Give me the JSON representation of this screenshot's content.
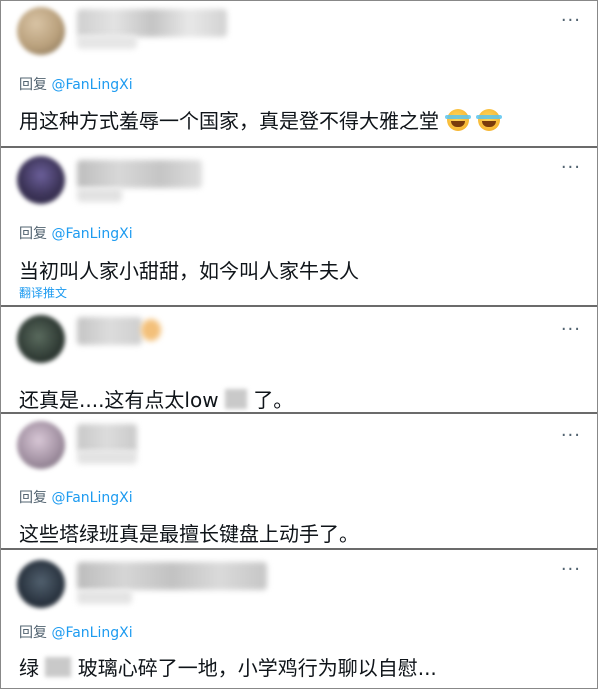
{
  "ui": {
    "more_glyph": "···",
    "reply_prefix": "回复",
    "translate_label": "翻译推文"
  },
  "tweets": [
    {
      "reply_to": "@FanLingXi",
      "text": "用这种方式羞辱一个国家，真是登不得大雅之堂",
      "emoji": [
        "face-with-tears-of-joy",
        "face-with-tears-of-joy"
      ]
    },
    {
      "reply_to": "@FanLingXi",
      "text": "当初叫人家小甜甜，如今叫人家牛夫人",
      "has_translate": true
    },
    {
      "text_before": "还真是....这有点太low",
      "text_after": "了。"
    },
    {
      "reply_to": "@FanLingXi",
      "text": "这些塔绿班真是最擅长键盘上动手了。"
    },
    {
      "reply_to": "@FanLingXi",
      "text_before": "绿",
      "text_after": "玻璃心碎了一地，小学鸡行为聊以自慰..."
    }
  ],
  "colors": {
    "handle": "#1d9bf0",
    "secondary_text": "#536471",
    "divider": "#6b6b6b"
  }
}
